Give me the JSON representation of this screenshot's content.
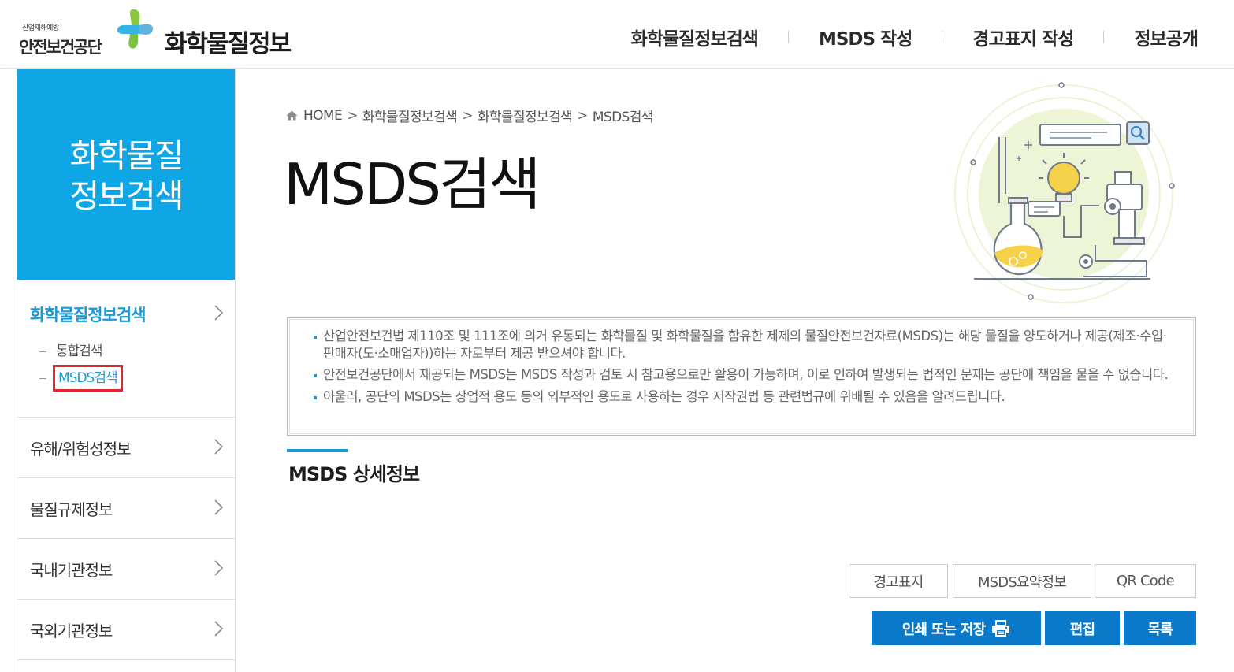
{
  "header": {
    "org_small": "산업재해예방",
    "org_name": "안전보건공단",
    "site_name": "화학물질정보",
    "nav": [
      {
        "label": "화학물질정보검색"
      },
      {
        "label": "MSDS 작성"
      },
      {
        "label": "경고표지 작성"
      },
      {
        "label": "정보공개"
      }
    ]
  },
  "sidebar": {
    "hero_title": "화학물질 정보검색",
    "items": [
      {
        "label": "화학물질정보검색",
        "subitems": [
          {
            "label": "통합검색"
          },
          {
            "label": "MSDS검색"
          }
        ]
      },
      {
        "label": "유해/위험성정보"
      },
      {
        "label": "물질규제정보"
      },
      {
        "label": "국내기관정보"
      },
      {
        "label": "국외기관정보"
      }
    ]
  },
  "breadcrumb": [
    "HOME",
    "화학물질정보검색",
    "화학물질정보검색",
    "MSDS검색"
  ],
  "page_title": "MSDS검색",
  "notice": [
    "산업안전보건법 제110조 및 111조에 의거 유통되는 화학물질 및 화학물질을 함유한 제제의 물질안전보건자료(MSDS)는 해당 물질을 양도하거나 제공(제조·수입·판매자(도·소매업자))하는 자로부터 제공 받으셔야 합니다.",
    "안전보건공단에서 제공되는 MSDS는 MSDS 작성과 검토 시 참고용으로만 활용이 가능하며, 이로 인하여 발생되는 법적인 문제는 공단에 책임을 물을 수 없습니다.",
    "아울러, 공단의 MSDS는 상업적 용도 등의 외부적인 용도로 사용하는 경우 저작권법 등 관련법규에 위배될 수 있음을 알려드립니다."
  ],
  "section_title": "MSDS 상세정보",
  "buttons": {
    "warning_label": "경고표지",
    "summary": "MSDS요약정보",
    "qr": "QR Code",
    "print": "인쇄 또는 저장",
    "edit": "편집",
    "list": "목록"
  },
  "colors": {
    "primary": "#0fa6e5",
    "accent_text": "#1a9ad6",
    "button": "#0b79c9",
    "highlight_box": "#e0262c"
  },
  "icons": [
    "home-icon",
    "chevron-right-icon",
    "print-icon",
    "search-icon",
    "lightbulb-icon",
    "flask-icon",
    "microscope-icon"
  ]
}
